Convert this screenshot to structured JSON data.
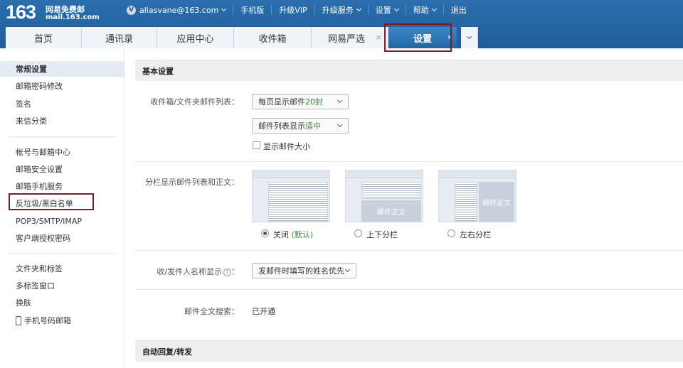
{
  "header": {
    "logo_number": "163",
    "logo_title": "网易免费邮",
    "logo_domain": "mail.163.com",
    "vip_badge": "V",
    "user_email": "aliasvane@163.com",
    "nav": [
      "手机版",
      "升级VIP",
      "升级服务",
      "设置",
      "帮助",
      "退出"
    ]
  },
  "tabs": {
    "items": [
      "首页",
      "通讯录",
      "应用中心",
      "收件箱",
      "网易严选"
    ],
    "close": "×",
    "active": "设置",
    "active_arrow": "›"
  },
  "sidebar": {
    "group1": [
      "常规设置",
      "邮箱密码修改",
      "签名",
      "来信分类"
    ],
    "group2": [
      "帐号与邮箱中心",
      "邮箱安全设置",
      "邮箱手机服务",
      "反垃圾/黑白名单",
      "POP3/SMTP/IMAP",
      "客户端授权密码"
    ],
    "group3": [
      "文件夹和标签",
      "多标签窗口",
      "换肤",
      "手机号码邮箱"
    ]
  },
  "main": {
    "section_basic": "基本设置",
    "list_label": "收件箱/文件夹邮件列表：",
    "per_page_prefix": "每页显示邮件",
    "per_page_value": "20封",
    "list_display_prefix": "邮件列表显示",
    "list_display_value": "适中",
    "show_size_label": "显示邮件大小",
    "split_label": "分栏显示邮件列表和正文：",
    "pane_text_1": "邮件正文",
    "pane_text_2": "邮件正文",
    "radio_off": "关闭",
    "radio_off_default": "(默认)",
    "radio_tb": "上下分栏",
    "radio_lr": "左右分栏",
    "sender_name_label": "收/发件人名称显示",
    "help_glyph": "?",
    "label_colon": "：",
    "sender_name_value": "发邮件时填写的姓名优先",
    "fulltext_label": "邮件全文搜索：",
    "fulltext_value": "已开通",
    "section_auto": "自动回复/转发"
  },
  "colors": {
    "header_blue": "#1f5d99",
    "active_tab": "#2167a8",
    "highlight_box": "#7b1b24",
    "green_value": "#2f8a2f"
  }
}
